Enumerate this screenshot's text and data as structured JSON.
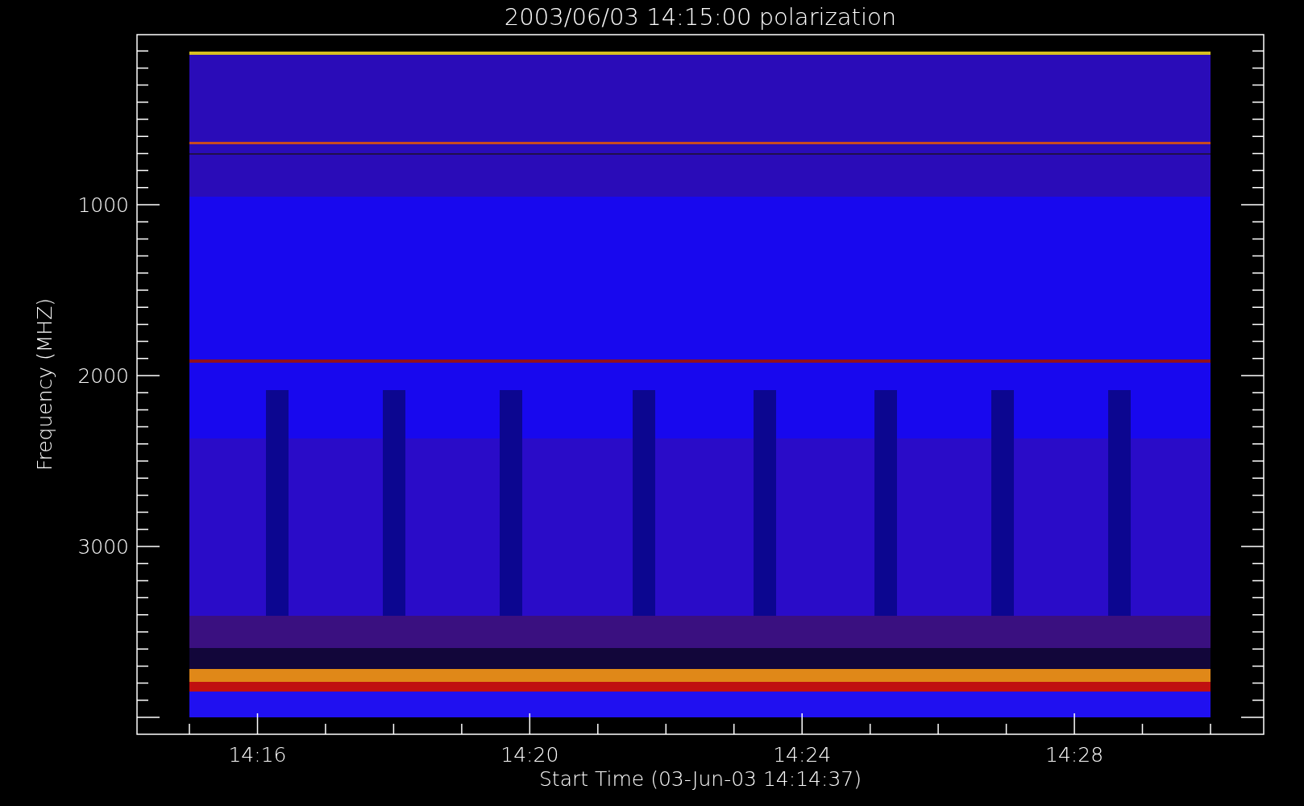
{
  "plot": {
    "title": "2003/06/03 14:15:00 polarization",
    "xlabel": "Start Time (03-Jun-03 14:14:37)",
    "ylabel": "Frequency (MHZ)",
    "xticks": [
      "14:16",
      "14:20",
      "14:24",
      "14:28"
    ],
    "yticks": [
      "1000",
      "2000",
      "3000"
    ],
    "spectrogram": {
      "kind": "picture"
    }
  }
}
